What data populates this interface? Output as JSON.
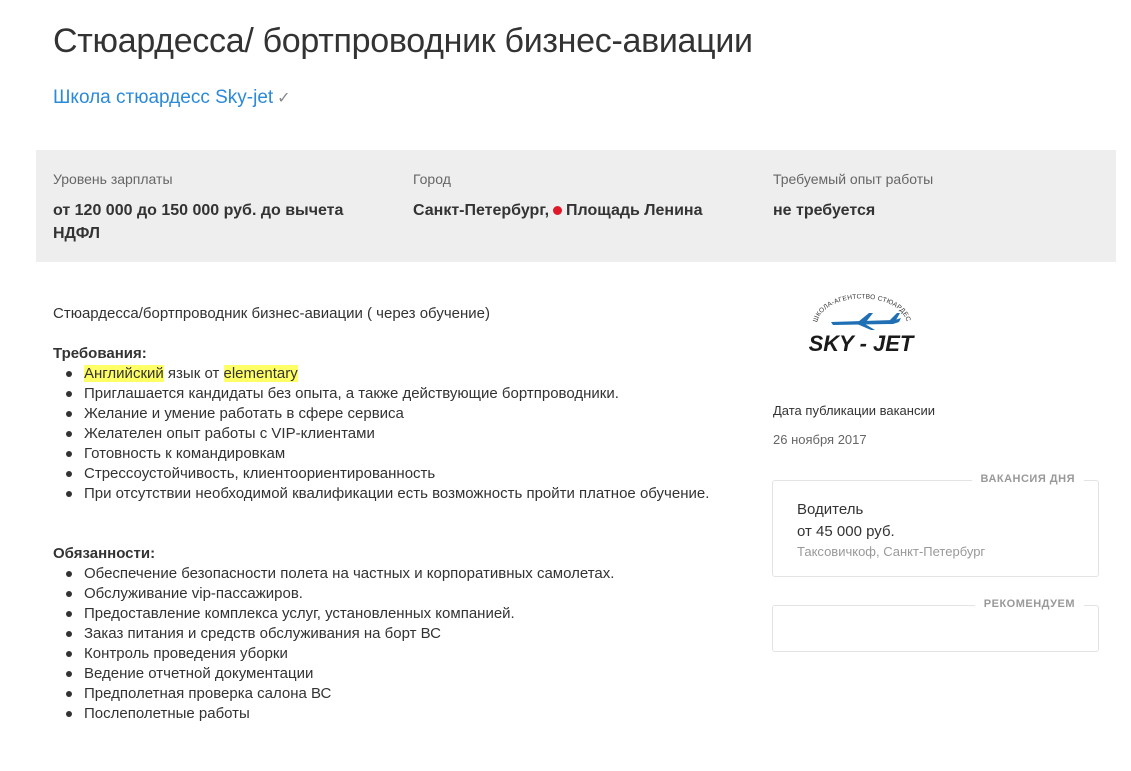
{
  "vacancy": {
    "title": "Стюардесса/ бортпроводник бизнес-авиации",
    "company": "Школа стюардесс Sky-jet",
    "verified_icon": "check-icon"
  },
  "info": {
    "salary_label": "Уровень зарплаты",
    "salary_value": "от 120 000 до 150 000 руб. до вычета НДФЛ",
    "city_label": "Город",
    "city_name": "Санкт-Петербург,",
    "metro_station": "Площадь Ленина",
    "metro_color": "#e0192a",
    "experience_label": "Требуемый опыт работы",
    "experience_value": "не требуется"
  },
  "description": {
    "lead": "Стюардесса/бортпроводник бизнес-авиации ( через обучение)",
    "requirements_title": "Требования:",
    "requirements_first": {
      "word1": "Английский",
      "middle": " язык от ",
      "word2": "elementary"
    },
    "requirements": [
      "Приглашается кандидаты без опыта, а также действующие бортпроводники.",
      "Желание и умение работать в сфере сервиса",
      "Желателен опыт работы с VIP-клиентами",
      "Готовность к командировкам",
      "Стрессоустойчивость, клиентоориентированность",
      "При отсутствии необходимой квалификации есть возможность пройти платное обучение."
    ],
    "duties_title": "Обязанности:",
    "duties": [
      "Обеспечение безопасности полета на частных и корпоративных самолетах.",
      "Обслуживание vip-пассажиров.",
      "Предоставление комплекса услуг, установленных компанией.",
      "Заказ питания и средств обслуживания на борт ВС",
      "Контроль проведения уборки",
      "Ведение отчетной документации",
      "Предполетная проверка салона ВС",
      "Послеполетные работы"
    ]
  },
  "sidebar": {
    "logo": {
      "arc_text": "ШКОЛА-АГЕНТСТВО СТЮАРДЕСС",
      "main_text": "SKY - JET"
    },
    "published_label": "Дата публикации вакансии",
    "published_date": "26 ноября 2017",
    "vacancy_of_day": {
      "badge": "ВАКАНСИЯ ДНЯ",
      "title": "Водитель",
      "salary": "от 45 000 руб.",
      "company": "Таксовичкоф, Санкт-Петербург"
    },
    "recommend_badge": "РЕКОМЕНДУЕМ"
  },
  "colors": {
    "link": "#2b8ad9",
    "highlight": "#ffff66",
    "panel_bg": "#eeeeee"
  }
}
